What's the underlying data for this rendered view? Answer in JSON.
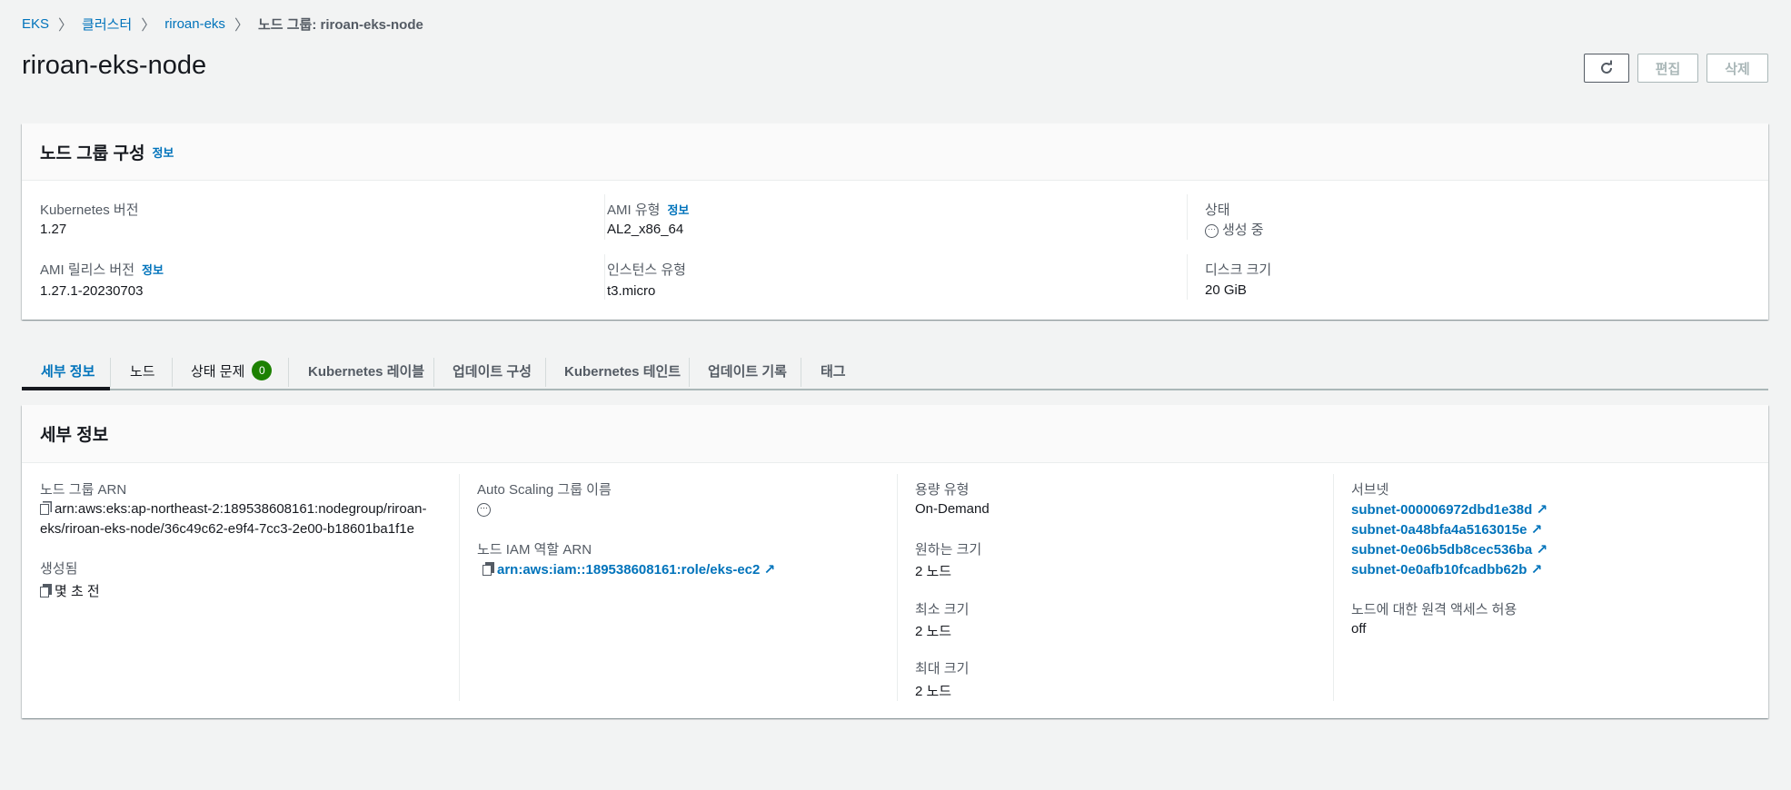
{
  "breadcrumb": [
    {
      "label": "EKS"
    },
    {
      "label": "클러스터"
    },
    {
      "label": "riroan-eks"
    },
    {
      "label": "노드 그룹: riroan-eks-node"
    }
  ],
  "page_title": "riroan-eks-node",
  "actions": {
    "edit": "편집",
    "delete": "삭제"
  },
  "config": {
    "title": "노드 그룹 구성",
    "info": "정보",
    "k8s_version_label": "Kubernetes 버전",
    "k8s_version": "1.27",
    "ami_type_label": "AMI 유형",
    "ami_type": "AL2_x86_64",
    "status_label": "상태",
    "status": "생성 중",
    "ami_release_label": "AMI 릴리스 버전",
    "ami_release": "1.27.1-20230703",
    "instance_type_label": "인스턴스 유형",
    "instance_type": "t3.micro",
    "disk_label": "디스크 크기",
    "disk": "20 GiB"
  },
  "tabs": [
    {
      "label": "세부 정보"
    },
    {
      "label": "노드"
    },
    {
      "label": "상태 문제",
      "count": "0"
    },
    {
      "label": "Kubernetes 레이블"
    },
    {
      "label": "업데이트 구성"
    },
    {
      "label": "Kubernetes 테인트"
    },
    {
      "label": "업데이트 기록"
    },
    {
      "label": "태그"
    }
  ],
  "details": {
    "title": "세부 정보",
    "arn_label": "노드 그룹 ARN",
    "arn_line1": "arn:aws:eks:ap-northeast-2:189538608161:nodegroup/riroan-",
    "arn_line2": "eks/riroan-eks-node/36c49c62-e9f4-7cc3-2e00-b18601ba1f1e",
    "created_label": "생성됨",
    "created": "몇 초 전",
    "asg_label": "Auto Scaling 그룹 이름",
    "iam_label": "노드 IAM 역할 ARN",
    "iam": "arn:aws:iam::189538608161:role/eks-ec2",
    "capacity_label": "용량 유형",
    "capacity": "On-Demand",
    "desired_label": "원하는 크기",
    "desired": "2 노드",
    "min_label": "최소 크기",
    "min": "2 노드",
    "max_label": "최대 크기",
    "max": "2 노드",
    "subnets_label": "서브넷",
    "subnets": [
      "subnet-000006972dbd1e38d",
      "subnet-0a48bfa4a5163015e",
      "subnet-0e06b5db8cec536ba",
      "subnet-0e0afb10fcadbb62b"
    ],
    "remote_label": "노드에 대한 원격 액세스 허용",
    "remote": "off"
  }
}
